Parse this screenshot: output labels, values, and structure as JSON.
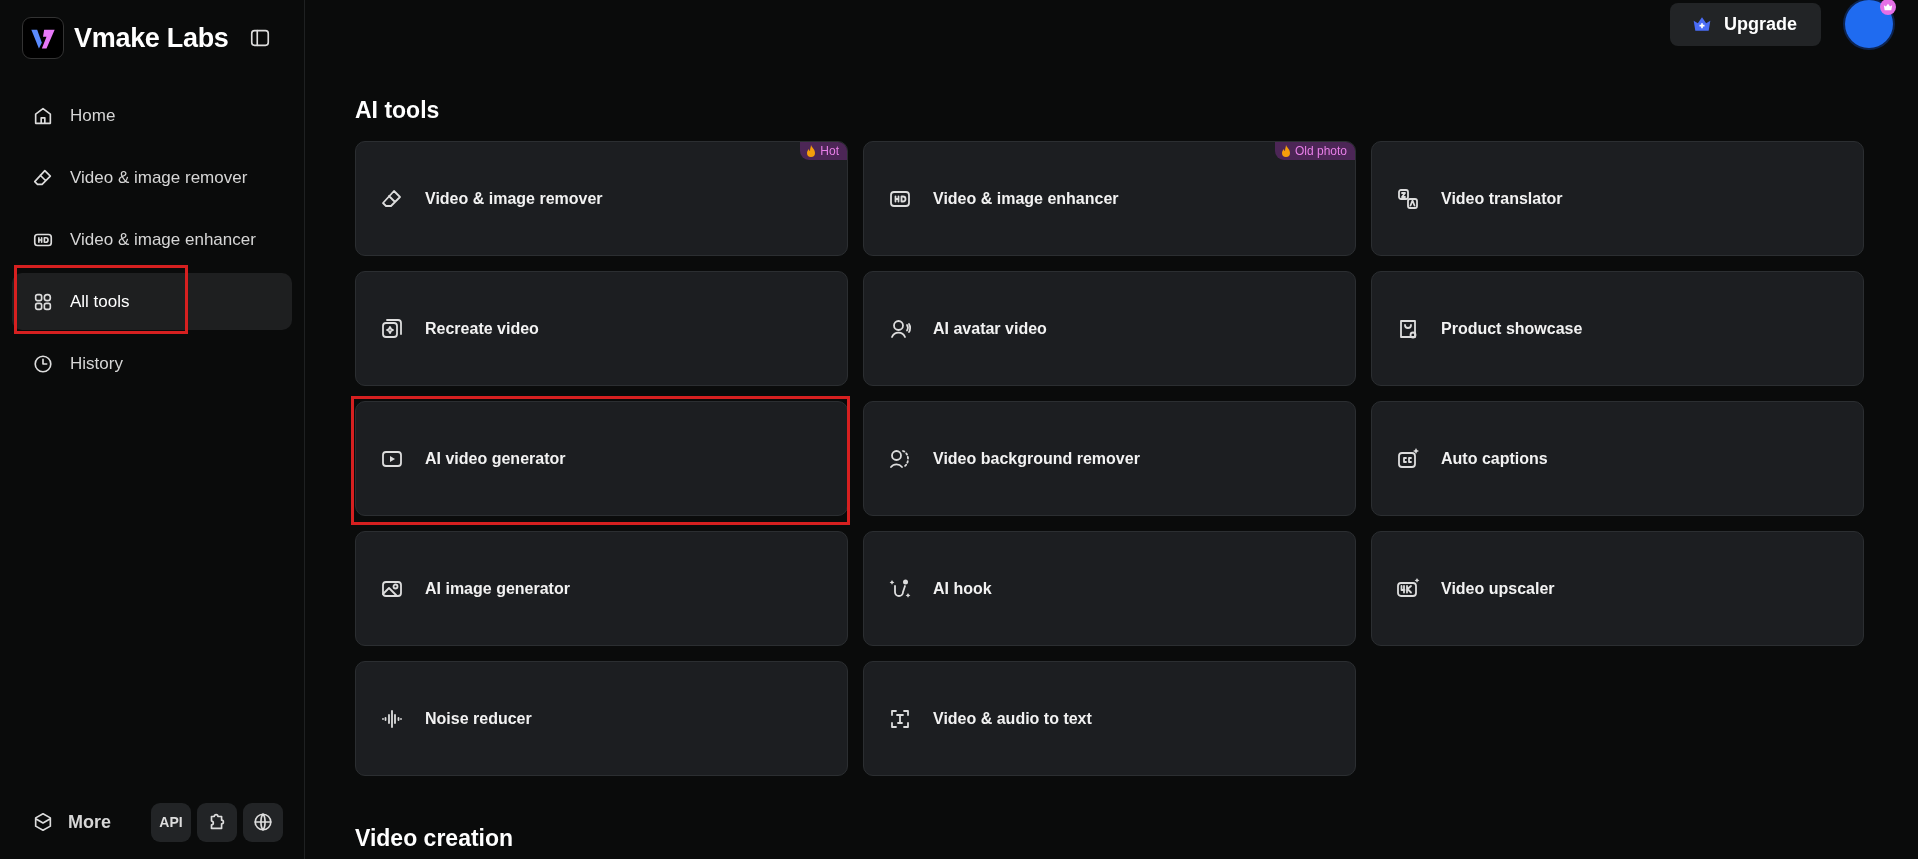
{
  "brand": {
    "name": "Vmake Labs"
  },
  "sidebar": {
    "items": [
      {
        "label": "Home",
        "selected": false,
        "highlighted": false
      },
      {
        "label": "Video & image remover",
        "selected": false,
        "highlighted": false
      },
      {
        "label": "Video & image enhancer",
        "selected": false,
        "highlighted": false
      },
      {
        "label": "All tools",
        "selected": true,
        "highlighted": true
      },
      {
        "label": "History",
        "selected": false,
        "highlighted": false
      }
    ],
    "more": "More",
    "api": "API"
  },
  "header": {
    "upgrade": "Upgrade"
  },
  "sections": [
    {
      "title": "AI tools",
      "tools": [
        {
          "label": "Video & image remover",
          "badge": "Hot",
          "highlighted": false
        },
        {
          "label": "Video & image enhancer",
          "badge": "Old photo",
          "highlighted": false
        },
        {
          "label": "Video translator",
          "highlighted": false
        },
        {
          "label": "Recreate video",
          "highlighted": false
        },
        {
          "label": "AI avatar video",
          "highlighted": false
        },
        {
          "label": "Product showcase",
          "highlighted": false
        },
        {
          "label": "AI video generator",
          "highlighted": true
        },
        {
          "label": "Video background remover",
          "highlighted": false
        },
        {
          "label": "Auto captions",
          "highlighted": false
        },
        {
          "label": "AI image generator",
          "highlighted": false
        },
        {
          "label": "AI hook",
          "highlighted": false
        },
        {
          "label": "Video upscaler",
          "highlighted": false
        },
        {
          "label": "Noise reducer",
          "highlighted": false
        },
        {
          "label": "Video & audio to text",
          "highlighted": false
        }
      ]
    },
    {
      "title": "Video creation"
    }
  ]
}
